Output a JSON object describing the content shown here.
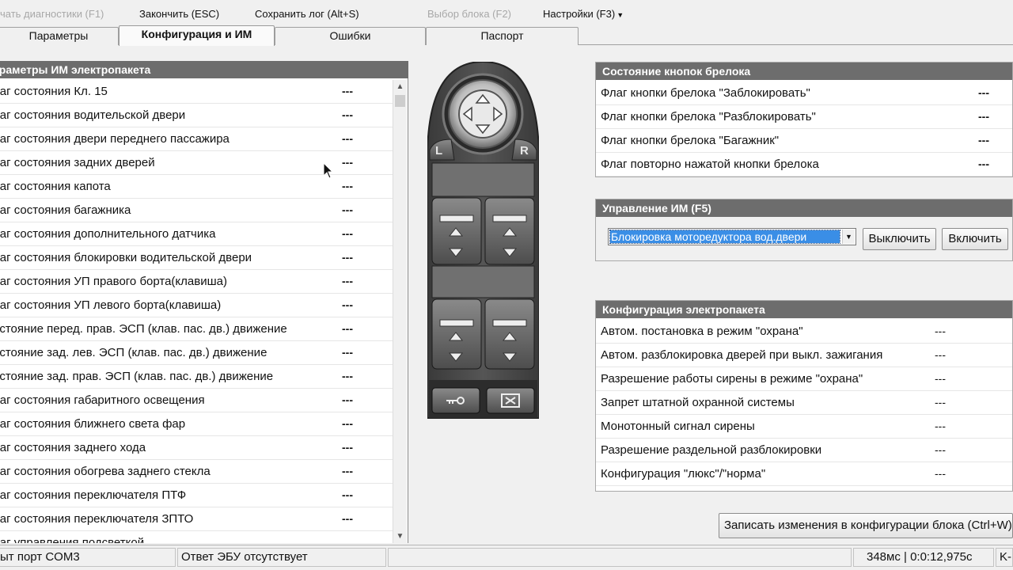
{
  "toolbar": {
    "start_diag": "чать диагностики (F1)",
    "finish": "Закончить (ESC)",
    "save_log": "Сохранить лог (Alt+S)",
    "select_block": "Выбор блока (F2)",
    "settings": "Настройки (F3)"
  },
  "tabs": {
    "params": "Параметры",
    "config": "Конфигурация и ИМ",
    "errors": "Ошибки",
    "passport": "Паспорт"
  },
  "left_panel": {
    "title": "араметры ИМ электропакета",
    "rows": [
      {
        "name": "лаг состояния Кл. 15",
        "value": "---"
      },
      {
        "name": "лаг состояния водительской двери",
        "value": "---"
      },
      {
        "name": "лаг состояния двери переднего пассажира",
        "value": "---"
      },
      {
        "name": "лаг состояния задних дверей",
        "value": "---"
      },
      {
        "name": "лаг состояния капота",
        "value": "---"
      },
      {
        "name": "лаг состояния багажника",
        "value": "---"
      },
      {
        "name": "лаг состояния дополнительного датчика",
        "value": "---"
      },
      {
        "name": "лаг состояния блокировки водительской двери",
        "value": "---"
      },
      {
        "name": "лаг состояния УП правого борта(клавиша)",
        "value": "---"
      },
      {
        "name": "лаг состояния УП левого борта(клавиша)",
        "value": "---"
      },
      {
        "name": "остояние перед. прав. ЭСП (клав. пас. дв.) движение",
        "value": "---"
      },
      {
        "name": "остояние зад. лев. ЭСП (клав. пас. дв.) движение",
        "value": "---"
      },
      {
        "name": "остояние зад. прав. ЭСП (клав. пас. дв.) движение",
        "value": "---"
      },
      {
        "name": "лаг состояния габаритного освещения",
        "value": "---"
      },
      {
        "name": "лаг состояния ближнего света фар",
        "value": "---"
      },
      {
        "name": "лаг состояния заднего хода",
        "value": "---"
      },
      {
        "name": "лаг состояния обогрева заднего стекла",
        "value": "---"
      },
      {
        "name": "лаг состояния переключателя ПТФ",
        "value": "---"
      },
      {
        "name": "лаг состояния переключателя ЗПТО",
        "value": "---"
      },
      {
        "name": "лаг управления подсветкой",
        "value": ""
      }
    ]
  },
  "door_panel": {
    "left_letter": "L",
    "right_letter": "R"
  },
  "fob_group": {
    "title": "Состояние кнопок брелока",
    "rows": [
      {
        "name": "Флаг кнопки брелока \"Заблокировать\"",
        "value": "---"
      },
      {
        "name": "Флаг кнопки брелока \"Разблокировать\"",
        "value": "---"
      },
      {
        "name": "Флаг кнопки брелока \"Багажник\"",
        "value": "---"
      },
      {
        "name": "Флаг повторно нажатой кнопки брелока",
        "value": "---"
      }
    ]
  },
  "control_group": {
    "title": "Управление ИМ (F5)",
    "selected": "Блокировка моторедуктора вод.двери",
    "off_label": "Выключить",
    "on_label": "Включить"
  },
  "config_group": {
    "title": "Конфигурация электропакета",
    "rows": [
      {
        "name": "Автом. постановка в режим \"охрана\"",
        "value": "---"
      },
      {
        "name": "Автом. разблокировка дверей при выкл. зажигания",
        "value": "---"
      },
      {
        "name": "Разрешение работы сирены в режиме \"охрана\"",
        "value": "---"
      },
      {
        "name": "Запрет штатной охранной системы",
        "value": "---"
      },
      {
        "name": "Монотонный сигнал сирены",
        "value": "---"
      },
      {
        "name": "Разрешение раздельной разблокировки",
        "value": "---"
      },
      {
        "name": "Конфигурация \"люкс\"/\"норма\"",
        "value": "---"
      }
    ]
  },
  "write_button": "Записать изменения в конфигурации блока (Ctrl+W)",
  "statusbar": {
    "port": "ыт порт COM3",
    "ecu": "Ответ ЭБУ отсутствует",
    "timing": "348мс | 0:0:12,975с",
    "extra": "K-"
  }
}
